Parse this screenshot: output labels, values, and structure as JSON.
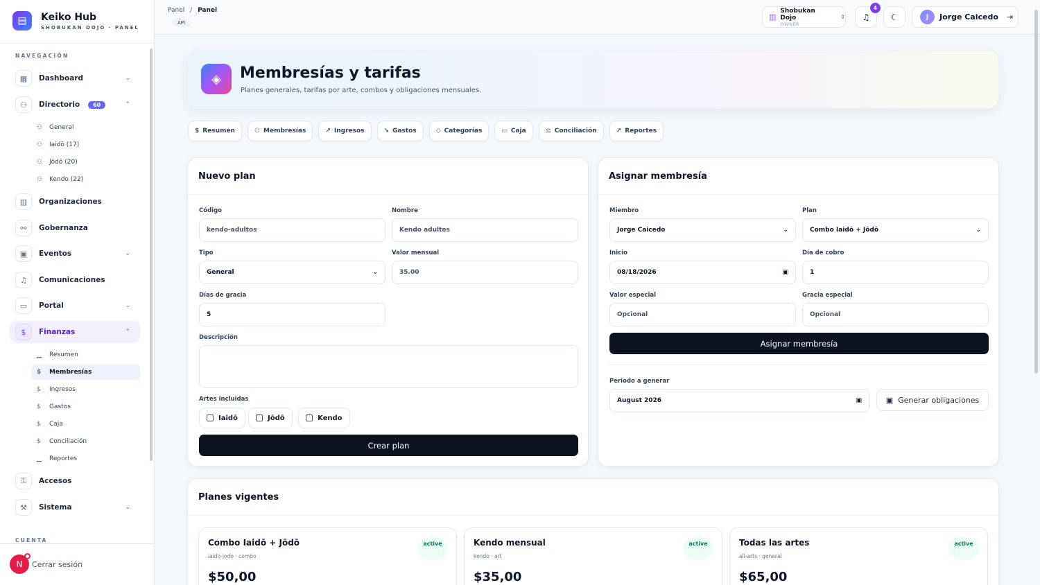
{
  "brand": {
    "title": "Keiko Hub",
    "subtitle": "SHOBUKAN DOJO · PANEL"
  },
  "sidebar": {
    "nav_heading": "NAVEGACIÓN",
    "items": {
      "dashboard": "Dashboard",
      "directorio": "Directorio",
      "directorio_badge": "60",
      "organizaciones": "Organizaciones",
      "gobernanza": "Gobernanza",
      "eventos": "Eventos",
      "comunicaciones": "Comunicaciones",
      "portal": "Portal",
      "finanzas": "Finanzas",
      "accesos": "Accesos",
      "sistema": "Sistema"
    },
    "directorio_sub": [
      "General",
      "Iaidō (17)",
      "Jōdō (20)",
      "Kendo (22)"
    ],
    "finanzas_sub": [
      "Resumen",
      "Membresías",
      "Ingresos",
      "Gastos",
      "Caja",
      "Conciliación",
      "Reportes"
    ],
    "account_heading": "CUENTA",
    "logout_label": "Cerrar sesión",
    "logout_avatar": "N"
  },
  "topbar": {
    "breadcrumb_root": "Panel",
    "breadcrumb_sep": "/",
    "breadcrumb_current": "Panel",
    "api_badge": "API",
    "org_name": "Shobukan Dojo",
    "org_role": "OWNER",
    "notifications_count": "4",
    "user_initial": "J",
    "user_name": "Jorge Caicedo"
  },
  "hero": {
    "title": "Membresías y tarifas",
    "subtitle": "Planes generales, tarifas por arte, combos y obligaciones mensuales."
  },
  "tabs": [
    "Resumen",
    "Membresías",
    "Ingresos",
    "Gastos",
    "Categorías",
    "Caja",
    "Conciliación",
    "Reportes"
  ],
  "nuevo_plan": {
    "title": "Nuevo plan",
    "codigo_label": "Código",
    "codigo_placeholder": "kendo-adultos",
    "nombre_label": "Nombre",
    "nombre_placeholder": "Kendo adultos",
    "tipo_label": "Tipo",
    "tipo_value": "General",
    "valor_label": "Valor mensual",
    "valor_value": "35.00",
    "gracia_label": "Días de gracia",
    "gracia_value": "5",
    "descripcion_label": "Descripción",
    "artes_label": "Artes incluidas",
    "artes": [
      "Iaidō",
      "Jōdō",
      "Kendo"
    ],
    "submit": "Crear plan"
  },
  "asignar": {
    "title": "Asignar membresía",
    "miembro_label": "Miembro",
    "miembro_value": "Jorge Caicedo",
    "plan_label": "Plan",
    "plan_value": "Combo Iaidō + Jōdō",
    "inicio_label": "Inicio",
    "inicio_value": "08/18/2026",
    "dia_label": "Día de cobro",
    "dia_value": "1",
    "valor_label": "Valor especial",
    "valor_placeholder": "Opcional",
    "gracia_label": "Gracia especial",
    "gracia_placeholder": "Opcional",
    "submit": "Asignar membresía",
    "periodo_label": "Periodo a generar",
    "periodo_value": "August 2026",
    "generar": "Generar obligaciones"
  },
  "planes": {
    "title": "Planes vigentes",
    "items": [
      {
        "name": "Combo Iaidō + Jōdō",
        "meta": "iaido-jodo · combo",
        "price": "$50,00",
        "status": "active"
      },
      {
        "name": "Kendo mensual",
        "meta": "kendo · art",
        "price": "$35,00",
        "status": "active"
      },
      {
        "name": "Todas las artes",
        "meta": "all-arts · general",
        "price": "$65,00",
        "status": "active"
      }
    ]
  },
  "colors": {
    "accent": "#7c3aed",
    "dark_button": "#0b1220",
    "badge": "#6366f1",
    "active_green": "#047857"
  }
}
